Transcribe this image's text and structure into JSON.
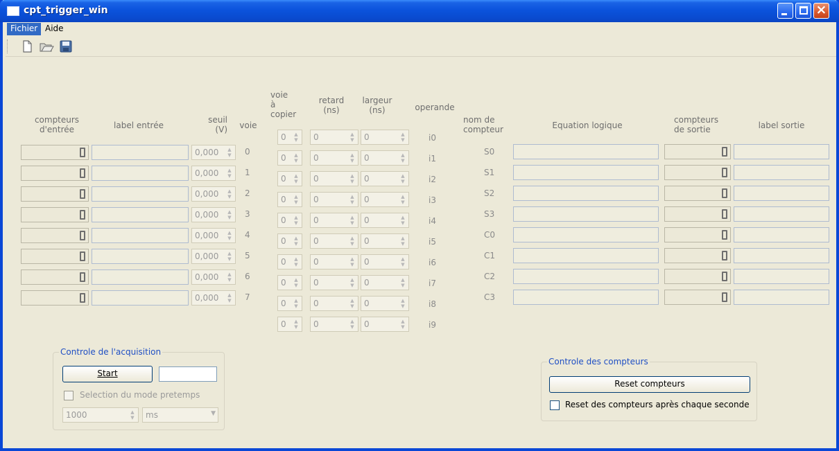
{
  "window": {
    "title": "cpt_trigger_win"
  },
  "menu": {
    "fichier": "Fichier",
    "aide": "Aide"
  },
  "toolbar": {
    "icons": [
      "new-file-icon",
      "open-folder-icon",
      "save-disk-icon"
    ]
  },
  "headers": {
    "compteurs_entree": [
      "compteurs",
      "d'entrée"
    ],
    "label_entree": "label entrée",
    "seuil": [
      "seuil",
      "(V)"
    ],
    "voie": "voie",
    "voie_a_copier": [
      "voie",
      "à",
      "copier"
    ],
    "retard": [
      "retard",
      "(ns)"
    ],
    "largeur": [
      "largeur",
      "(ns)"
    ],
    "operande": "operande",
    "nom_compteur": [
      "nom de",
      "compteur"
    ],
    "equation_logique": "Equation logique",
    "compteurs_sortie": [
      "compteurs",
      "de sortie"
    ],
    "label_sortie": "label sortie"
  },
  "inputs": [
    {
      "seuil": "0,000",
      "voie": "0"
    },
    {
      "seuil": "0,000",
      "voie": "1"
    },
    {
      "seuil": "0,000",
      "voie": "2"
    },
    {
      "seuil": "0,000",
      "voie": "3"
    },
    {
      "seuil": "0,000",
      "voie": "4"
    },
    {
      "seuil": "0,000",
      "voie": "5"
    },
    {
      "seuil": "0,000",
      "voie": "6"
    },
    {
      "seuil": "0,000",
      "voie": "7"
    }
  ],
  "operands": [
    {
      "voie": "0",
      "retard": "0",
      "largeur": "0",
      "name": "i0"
    },
    {
      "voie": "0",
      "retard": "0",
      "largeur": "0",
      "name": "i1"
    },
    {
      "voie": "0",
      "retard": "0",
      "largeur": "0",
      "name": "i2"
    },
    {
      "voie": "0",
      "retard": "0",
      "largeur": "0",
      "name": "i3"
    },
    {
      "voie": "0",
      "retard": "0",
      "largeur": "0",
      "name": "i4"
    },
    {
      "voie": "0",
      "retard": "0",
      "largeur": "0",
      "name": "i5"
    },
    {
      "voie": "0",
      "retard": "0",
      "largeur": "0",
      "name": "i6"
    },
    {
      "voie": "0",
      "retard": "0",
      "largeur": "0",
      "name": "i7"
    },
    {
      "voie": "0",
      "retard": "0",
      "largeur": "0",
      "name": "i8"
    },
    {
      "voie": "0",
      "retard": "0",
      "largeur": "0",
      "name": "i9"
    }
  ],
  "outputs": [
    {
      "name": "S0"
    },
    {
      "name": "S1"
    },
    {
      "name": "S2"
    },
    {
      "name": "S3"
    },
    {
      "name": "C0"
    },
    {
      "name": "C1"
    },
    {
      "name": "C2"
    },
    {
      "name": "C3"
    }
  ],
  "acquisition": {
    "title": "Controle de l'acquisition",
    "start_label": "Start",
    "start_field_value": "",
    "pretemps_label": "Selection du mode pretemps",
    "pretemps_checked": false,
    "pretemps_value": "1000",
    "unit": "ms"
  },
  "compteurs_control": {
    "title": "Controle des compteurs",
    "reset_label": "Reset compteurs",
    "reset_each_second_label": "Reset des compteurs après chaque seconde",
    "reset_each_second_checked": false
  }
}
